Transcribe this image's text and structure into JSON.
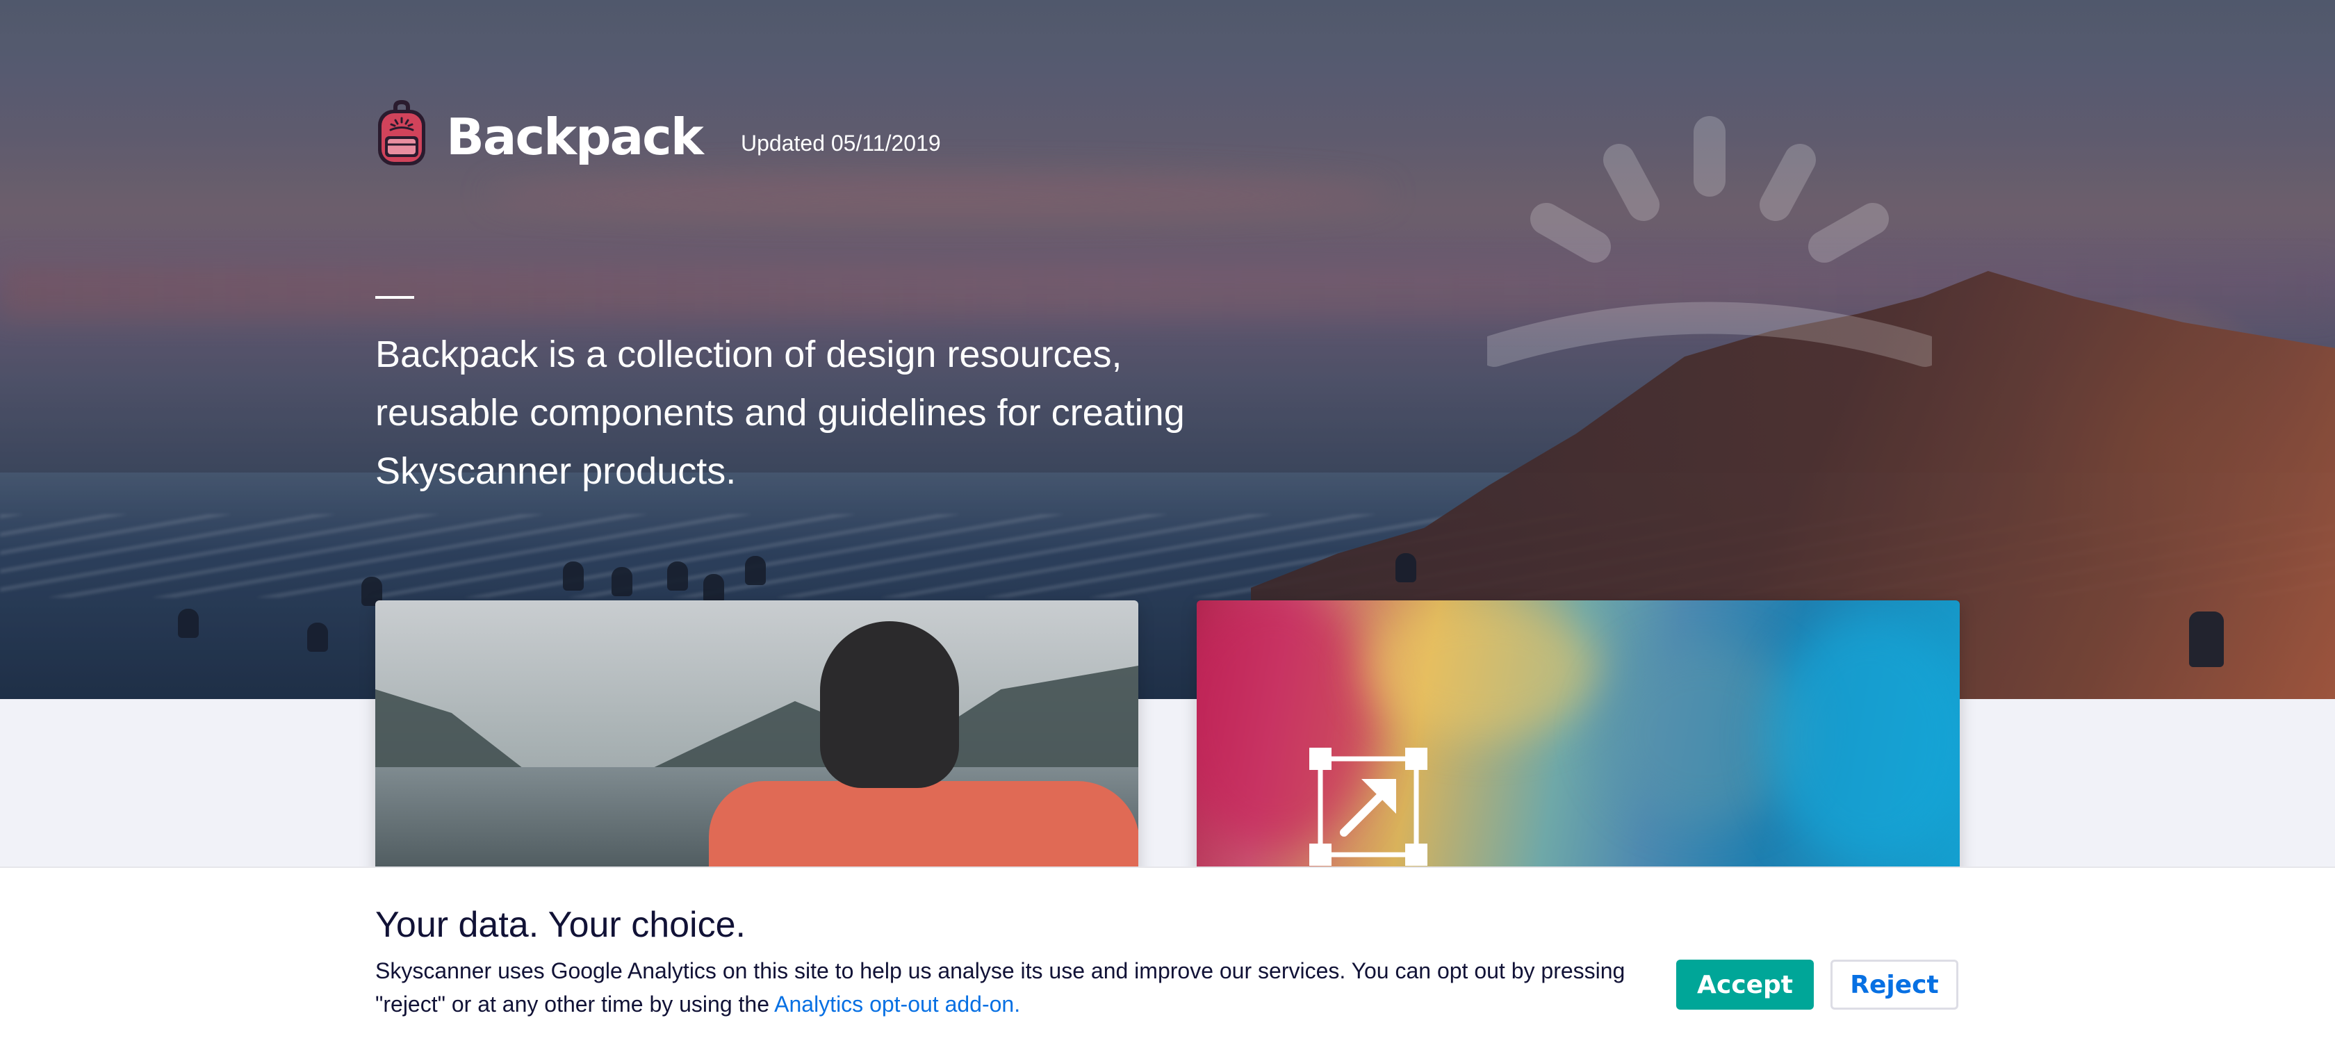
{
  "header": {
    "brand": "Backpack",
    "updated": "Updated 05/11/2019"
  },
  "intro": {
    "text": "Backpack is a collection of design resources, reusable components and guidelines for creating Skyscanner products."
  },
  "cards": [
    {
      "name": "components-card"
    },
    {
      "name": "resources-card"
    }
  ],
  "cookie_banner": {
    "title": "Your data. Your choice.",
    "body": "Skyscanner uses Google Analytics on this site to help us analyse its use and improve our services. You can opt out by pressing \"reject\" or at any other time by using the ",
    "link": "Analytics opt-out add-on.",
    "accept_label": "Accept",
    "reject_label": "Reject"
  },
  "colors": {
    "accept": "#00a698",
    "link": "#0770e3",
    "text": "#111236",
    "logo": "#d1435b"
  }
}
